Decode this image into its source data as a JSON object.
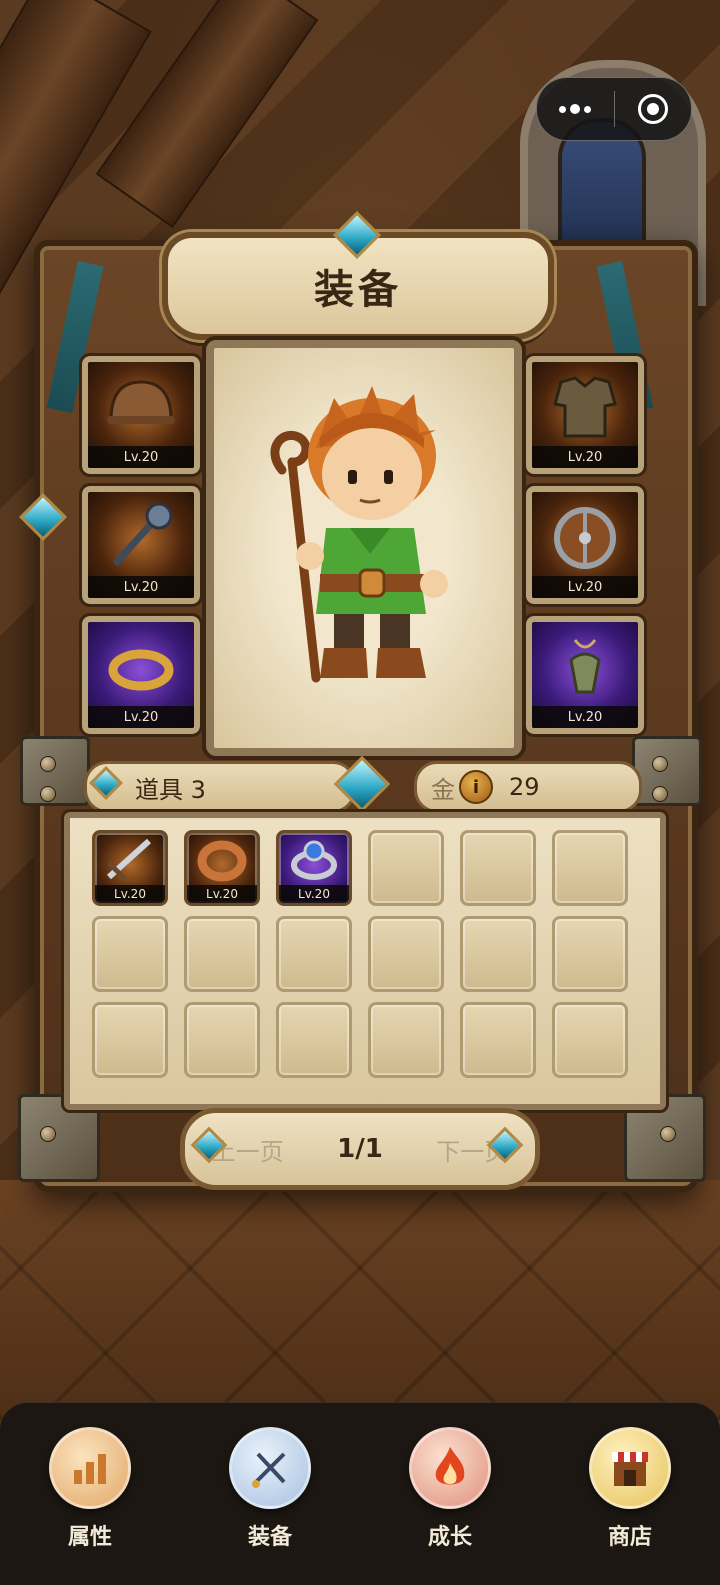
{
  "window_title": "装备",
  "capsule": {
    "more_icon": "more-dots-icon",
    "close_icon": "target-circle-icon"
  },
  "slots": {
    "left": [
      {
        "icon": "helmet",
        "level": "Lv.20",
        "rarity": "orange"
      },
      {
        "icon": "mace",
        "level": "Lv.20",
        "rarity": "orange"
      },
      {
        "icon": "ring-gold",
        "level": "Lv.20",
        "rarity": "purple"
      }
    ],
    "right": [
      {
        "icon": "armor",
        "level": "Lv.20",
        "rarity": "orange"
      },
      {
        "icon": "shield",
        "level": "Lv.20",
        "rarity": "orange"
      },
      {
        "icon": "amulet",
        "level": "Lv.20",
        "rarity": "purple"
      }
    ]
  },
  "infobar": {
    "items_label": "道具 3",
    "gold_prefix": "金",
    "gold_value": "29"
  },
  "bag": {
    "items": [
      {
        "icon": "sword",
        "level": "Lv.20",
        "rarity": "orange"
      },
      {
        "icon": "ring-copper",
        "level": "Lv.20",
        "rarity": "orange"
      },
      {
        "icon": "ring-blue",
        "level": "Lv.20",
        "rarity": "purple"
      }
    ],
    "total_cells": 18
  },
  "pager": {
    "prev": "上一页",
    "page": "1/1",
    "next": "下一页"
  },
  "nav": [
    {
      "label": "属性",
      "icon": "bar-chart-icon",
      "color": "#f0c489"
    },
    {
      "label": "装备",
      "icon": "sword-icon",
      "color": "#b8d0ea"
    },
    {
      "label": "成长",
      "icon": "flame-icon",
      "color": "#f0b49e"
    },
    {
      "label": "商店",
      "icon": "shop-icon",
      "color": "#f3d98a"
    }
  ]
}
